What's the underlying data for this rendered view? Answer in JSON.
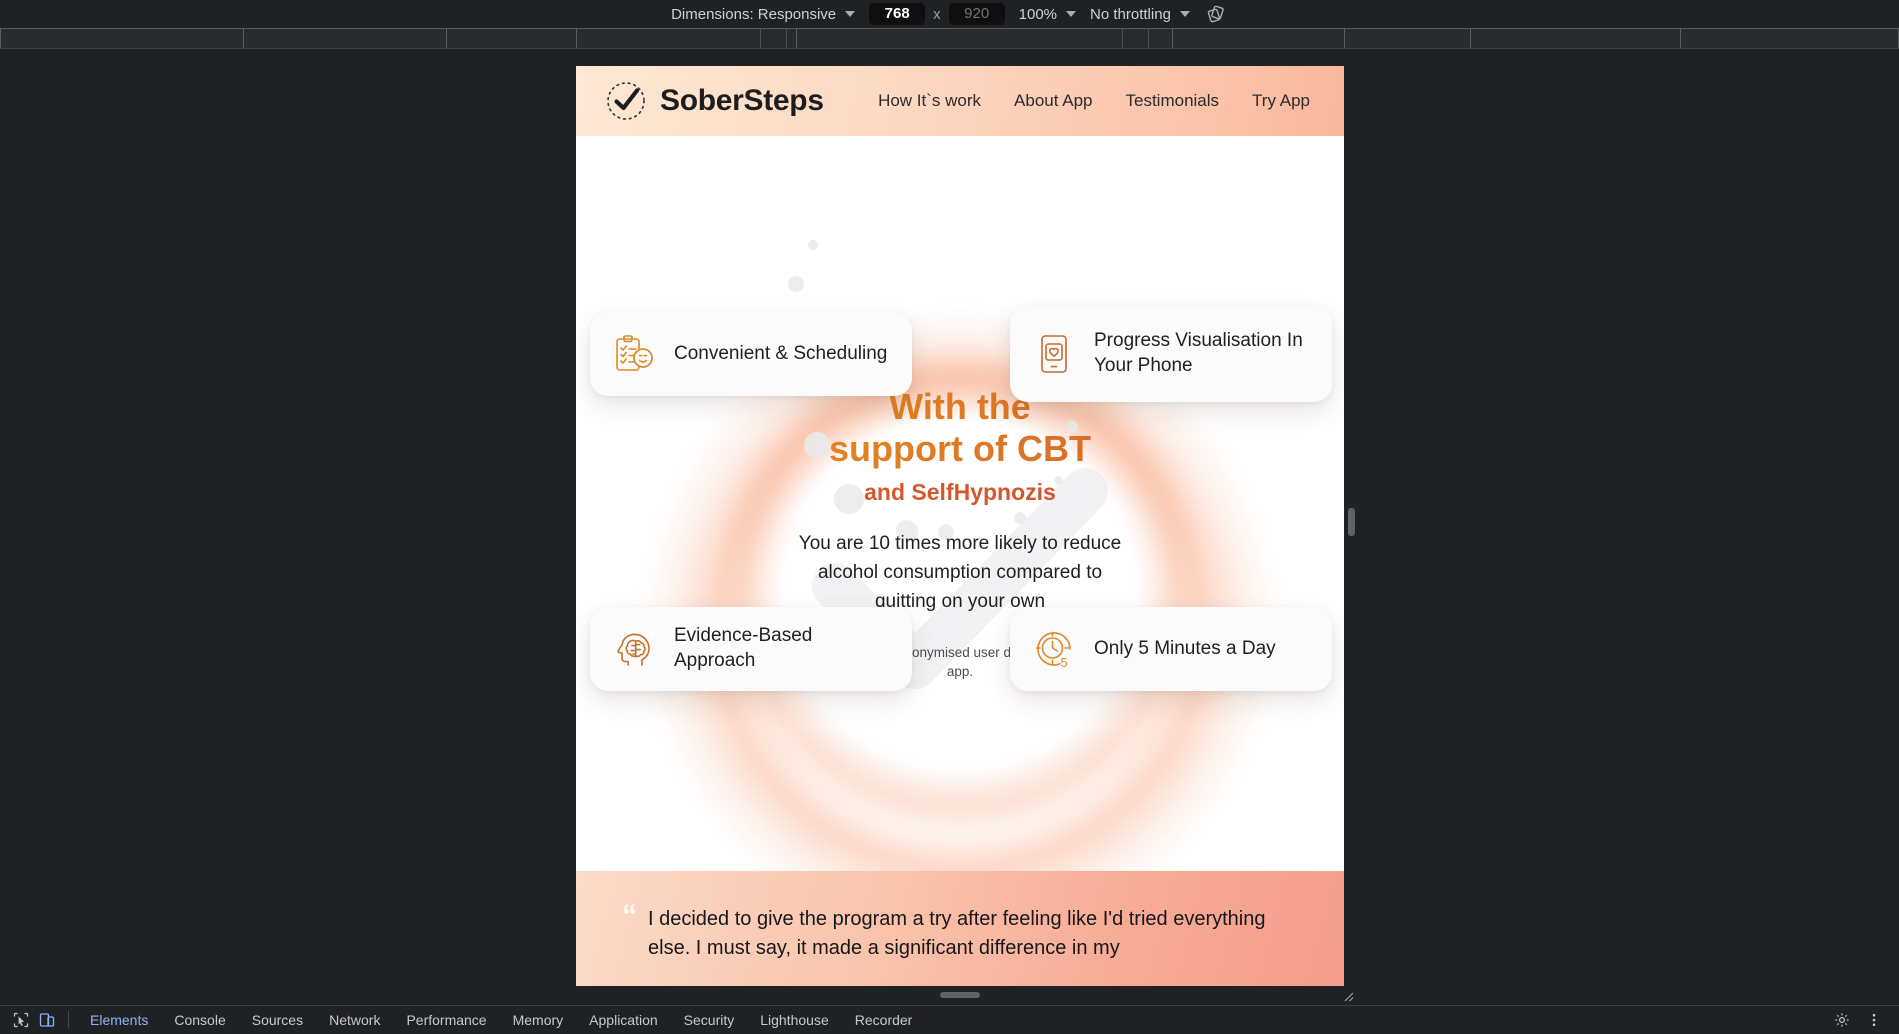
{
  "device_toolbar": {
    "dimensions_label": "Dimensions: Responsive",
    "width_value": "768",
    "height_placeholder": "920",
    "x_separator": "x",
    "zoom_label": "100%",
    "throttling_label": "No throttling",
    "rotate_icon": "rotate-device-icon"
  },
  "page": {
    "header": {
      "logo_icon": "check-circle-logo-icon",
      "brand": "SoberSteps",
      "nav": [
        {
          "label": "How It`s work"
        },
        {
          "label": "About App"
        },
        {
          "label": "Testimonials"
        },
        {
          "label": "Try App"
        }
      ]
    },
    "hero": {
      "headline_line1": "With the",
      "headline_line2": "support of CBT",
      "headline_line3": "and SelfHypnozis",
      "subtitle": "You are 10 times more likely to reduce alcohol consumption compared to quitting on your own",
      "note": "Based on anonymised user data from our app.",
      "cards": [
        {
          "icon": "clipboard-smiley-icon",
          "text": "Convenient & Scheduling"
        },
        {
          "icon": "phone-heart-icon",
          "text": "Progress Visualisation In Your Phone"
        },
        {
          "icon": "head-brain-icon",
          "text": "Evidence-Based Approach"
        },
        {
          "icon": "clock-five-icon",
          "text": "Only 5 Minutes a Day"
        }
      ]
    },
    "testimonial": {
      "quote_icon": "quotation-mark-icon",
      "text": "I decided to give the program a try after feeling like I'd tried everything else. I must say, it made a significant difference in my"
    }
  },
  "devtools": {
    "inspect_icon": "inspect-element-icon",
    "device_icon": "toggle-device-toolbar-icon",
    "tabs": [
      {
        "label": "Elements",
        "active": true
      },
      {
        "label": "Console",
        "active": false
      },
      {
        "label": "Sources",
        "active": false
      },
      {
        "label": "Network",
        "active": false
      },
      {
        "label": "Performance",
        "active": false
      },
      {
        "label": "Memory",
        "active": false
      },
      {
        "label": "Application",
        "active": false
      },
      {
        "label": "Security",
        "active": false
      },
      {
        "label": "Lighthouse",
        "active": false
      },
      {
        "label": "Recorder",
        "active": false
      }
    ],
    "settings_icon": "gear-icon",
    "more_icon": "more-options-icon"
  },
  "colors": {
    "accent_orange": "#df7d23",
    "accent_deep": "#d4582b",
    "header_gradient_start": "#fde8d3",
    "header_gradient_end": "#f8b79b",
    "devtools_bg": "#202124",
    "active_tab": "#8ab4f8"
  }
}
